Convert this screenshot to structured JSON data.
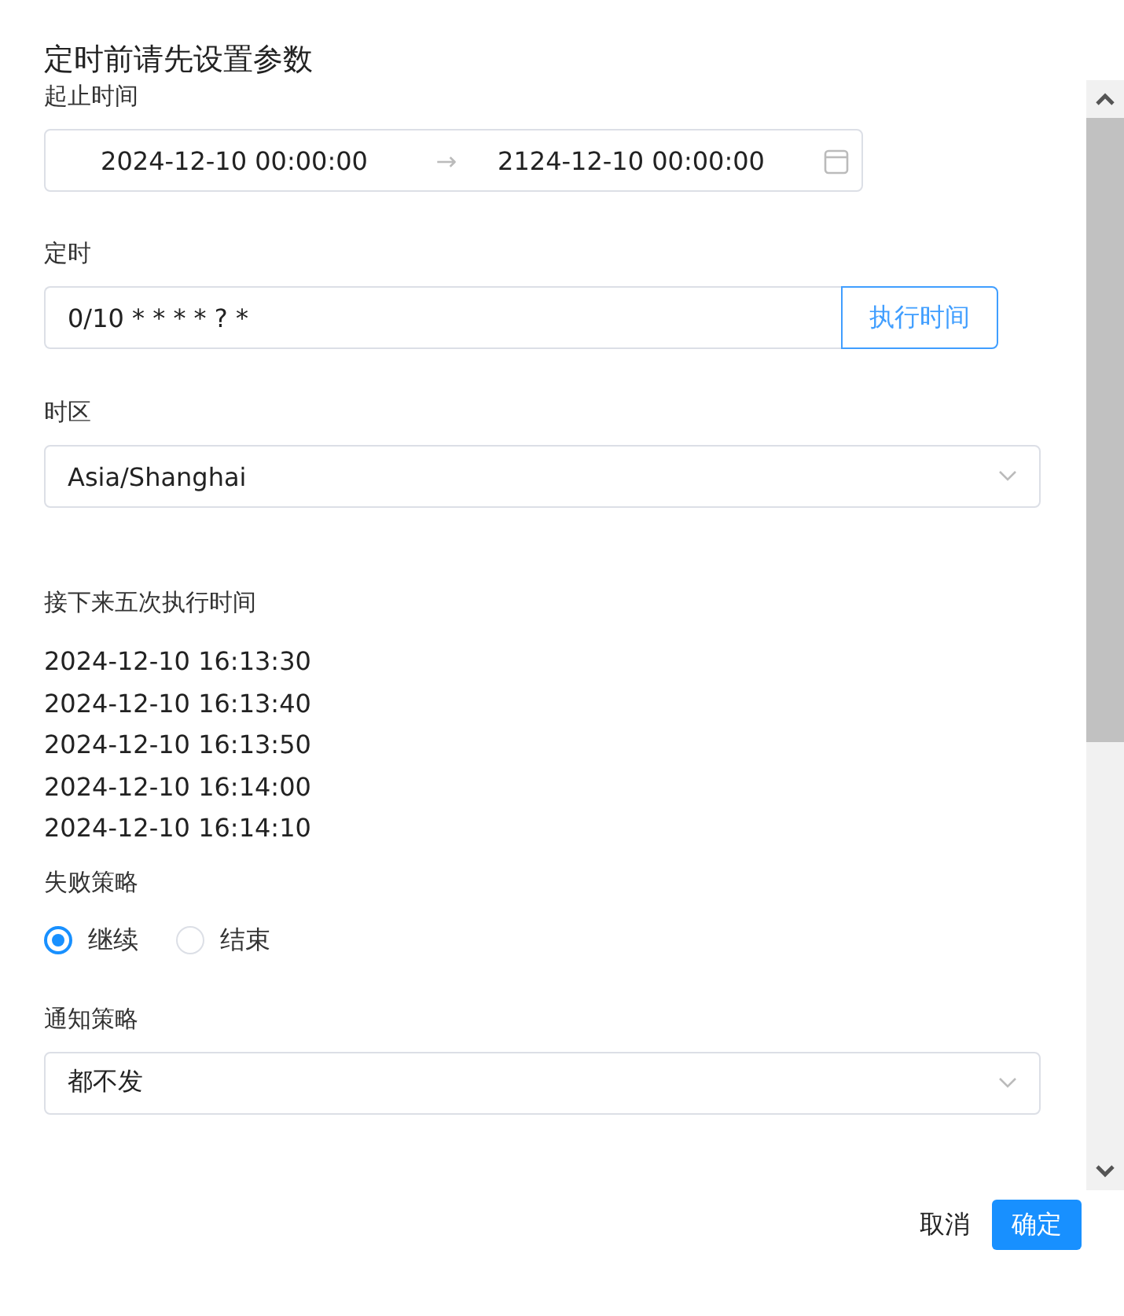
{
  "dialog": {
    "title": "定时前请先设置参数"
  },
  "time_range": {
    "label": "起止时间",
    "start": "2024-12-10 00:00:00",
    "separator": "→",
    "end": "2124-12-10 00:00:00"
  },
  "cron": {
    "label": "定时",
    "value": "0/10 * * * * ? *",
    "button": "执行时间"
  },
  "timezone": {
    "label": "时区",
    "value": "Asia/Shanghai"
  },
  "next_runs": {
    "label": "接下来五次执行时间",
    "times": [
      "2024-12-10 16:13:30",
      "2024-12-10 16:13:40",
      "2024-12-10 16:13:50",
      "2024-12-10 16:14:00",
      "2024-12-10 16:14:10"
    ]
  },
  "failure_strategy": {
    "label": "失败策略",
    "options": [
      {
        "label": "继续",
        "selected": true
      },
      {
        "label": "结束",
        "selected": false
      }
    ]
  },
  "notify_strategy": {
    "label": "通知策略",
    "value": "都不发"
  },
  "footer": {
    "cancel": "取消",
    "confirm": "确定"
  }
}
